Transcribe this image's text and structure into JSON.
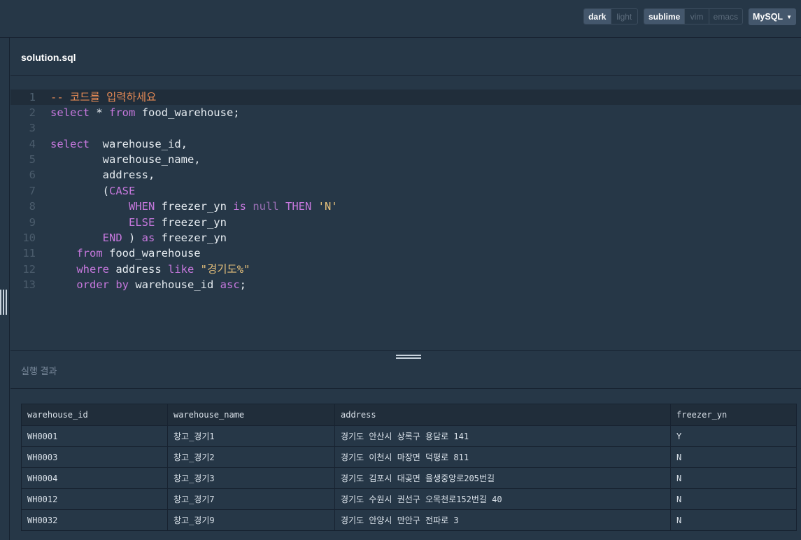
{
  "toolbar": {
    "theme": {
      "dark": "dark",
      "light": "light",
      "active": "dark"
    },
    "keymap": {
      "sublime": "sublime",
      "vim": "vim",
      "emacs": "emacs",
      "active": "sublime"
    },
    "language": "MySQL"
  },
  "file": {
    "name": "solution.sql"
  },
  "editor": {
    "line_numbers": [
      "1",
      "2",
      "3",
      "4",
      "5",
      "6",
      "7",
      "8",
      "9",
      "10",
      "11",
      "12",
      "13"
    ]
  },
  "results": {
    "label": "실행 결과",
    "columns": [
      "warehouse_id",
      "warehouse_name",
      "address",
      "freezer_yn"
    ],
    "rows": [
      [
        "WH0001",
        "창고_경기1",
        "경기도 안산시 상록구 용담로 141",
        "Y"
      ],
      [
        "WH0003",
        "창고_경기2",
        "경기도 이천시 마장면 덕평로 811",
        "N"
      ],
      [
        "WH0004",
        "창고_경기3",
        "경기도 김포시 대곶면 율생중앙로205번길",
        "N"
      ],
      [
        "WH0012",
        "창고_경기7",
        "경기도 수원시 권선구 오목천로152번길 40",
        "N"
      ],
      [
        "WH0032",
        "창고_경기9",
        "경기도 안양시 만안구 전파로 3",
        "N"
      ]
    ]
  },
  "colors": {
    "background": "#263747",
    "keyword": "#c678dd",
    "comment": "#e58a55",
    "string": "#e5c07b"
  }
}
